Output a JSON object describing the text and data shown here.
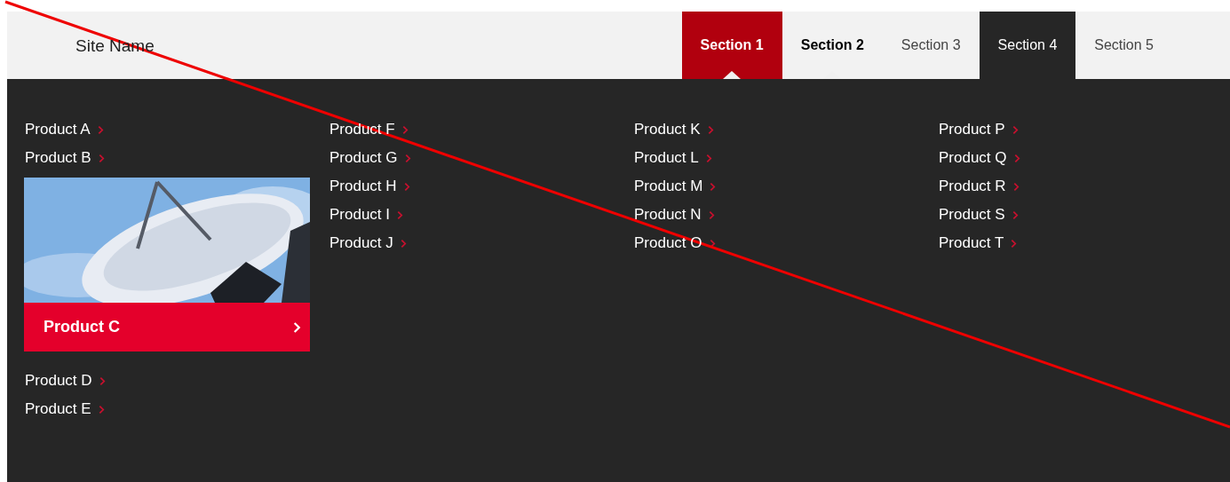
{
  "header": {
    "site_name": "Site Name"
  },
  "tabs": [
    {
      "label": "Section 1",
      "kind": "open",
      "selected": true
    },
    {
      "label": "Section 2",
      "kind": "open",
      "selected": false
    },
    {
      "label": "Section 3",
      "kind": "plain",
      "selected": false
    },
    {
      "label": "Section 4",
      "kind": "hover",
      "selected": false
    },
    {
      "label": "Section 5",
      "kind": "plain",
      "selected": false
    }
  ],
  "menu": {
    "columns": [
      {
        "items": [
          {
            "label": "Product A",
            "kind": "link"
          },
          {
            "label": "Product B",
            "kind": "link"
          },
          {
            "label": "Product C",
            "kind": "feature"
          },
          {
            "label": "Product D",
            "kind": "link"
          },
          {
            "label": "Product E",
            "kind": "link"
          }
        ]
      },
      {
        "items": [
          {
            "label": "Product F",
            "kind": "link"
          },
          {
            "label": "Product G",
            "kind": "link"
          },
          {
            "label": "Product H",
            "kind": "link"
          },
          {
            "label": "Product I",
            "kind": "link"
          },
          {
            "label": "Product J",
            "kind": "link"
          }
        ]
      },
      {
        "items": [
          {
            "label": "Product K",
            "kind": "link"
          },
          {
            "label": "Product L",
            "kind": "link"
          },
          {
            "label": "Product M",
            "kind": "link"
          },
          {
            "label": "Product N",
            "kind": "link"
          },
          {
            "label": "Product O",
            "kind": "link"
          }
        ]
      },
      {
        "items": [
          {
            "label": "Product P",
            "kind": "link"
          },
          {
            "label": "Product Q",
            "kind": "link"
          },
          {
            "label": "Product R",
            "kind": "link"
          },
          {
            "label": "Product S",
            "kind": "link"
          },
          {
            "label": "Product T",
            "kind": "link"
          }
        ]
      }
    ]
  }
}
